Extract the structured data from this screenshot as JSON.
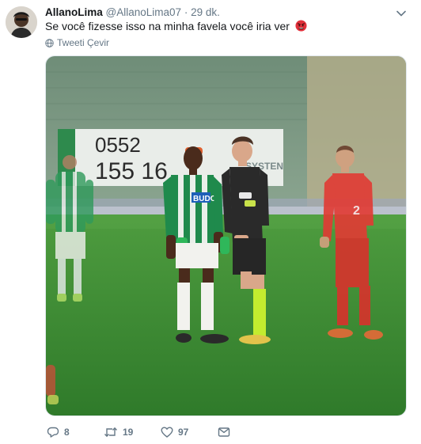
{
  "tweet": {
    "display_name": "AllanoLima",
    "handle": "@AllanoLima07",
    "separator": "·",
    "time": "29 dk.",
    "text": "Se você fizesse isso na minha favela você iria ver",
    "emoji": "angry-face-emoji",
    "translate_label": "Tweeti Çevir",
    "photo": {
      "billboard_line1": "0552",
      "billboard_line2": "155 16",
      "billboard_brand": "SYSTEN",
      "jersey_sponsor": "BUDO",
      "red_player_number": "2"
    }
  },
  "actions": {
    "reply_count": "8",
    "retweet_count": "19",
    "like_count": "97"
  },
  "colors": {
    "text": "#14171a",
    "secondary": "#657786",
    "pitch": "#3f8f35",
    "green_kit": "#1f8a4c",
    "referee_shirt": "#2a2a2a",
    "referee_socks": "#b5e53a",
    "red_kit": "#e23a34",
    "angry_emoji": "#e0303a"
  }
}
